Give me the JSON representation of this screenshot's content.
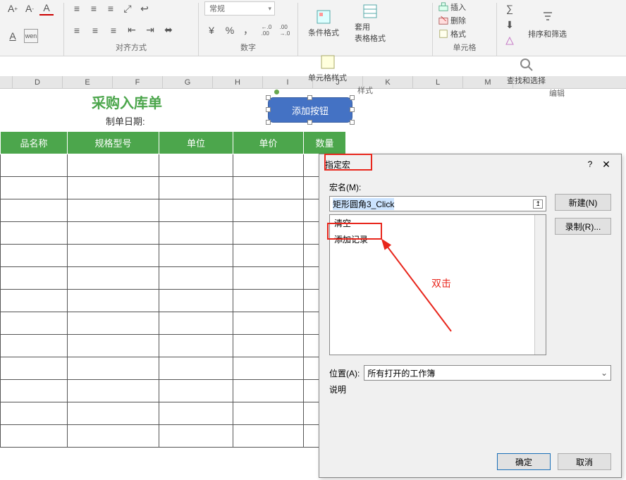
{
  "ribbon": {
    "font_btns": [
      "A",
      "A",
      "A",
      "A"
    ],
    "underline": "A",
    "wen": "wen",
    "number_format": "常规",
    "percent": "%",
    "comma": "，",
    "dec_inc": "00.0",
    "dec_dec": "0.00",
    "cond_fmt": "条件格式",
    "table_fmt": "套用\n表格格式",
    "cell_style": "单元格样式",
    "insert": "插入",
    "delete": "删除",
    "format": "格式",
    "sort_filter": "排序和筛选",
    "find_select": "查找和选择",
    "groups": {
      "align": "对齐方式",
      "number": "数字",
      "style": "样式",
      "cells": "单元格",
      "edit": "编辑"
    }
  },
  "columns": [
    "",
    "D",
    "E",
    "F",
    "G",
    "H",
    "I",
    "J",
    "K",
    "L",
    "M"
  ],
  "sheet": {
    "title": "采购入库单",
    "date_label": "制单日期:",
    "shape_button": "添加按钮",
    "headers": [
      "品名称",
      "规格型号",
      "单位",
      "单价",
      "数量"
    ]
  },
  "dialog": {
    "title": "指定宏",
    "macro_name_label": "宏名(M):",
    "macro_name": "矩形圆角3_Click",
    "list": [
      "清空",
      "添加记录"
    ],
    "btn_new": "新建(N)",
    "btn_record": "录制(R)...",
    "location_label": "位置(A):",
    "location_value": "所有打开的工作簿",
    "desc_label": "说明",
    "ok": "确定",
    "cancel": "取消"
  },
  "annotation": {
    "double_click": "双击"
  }
}
